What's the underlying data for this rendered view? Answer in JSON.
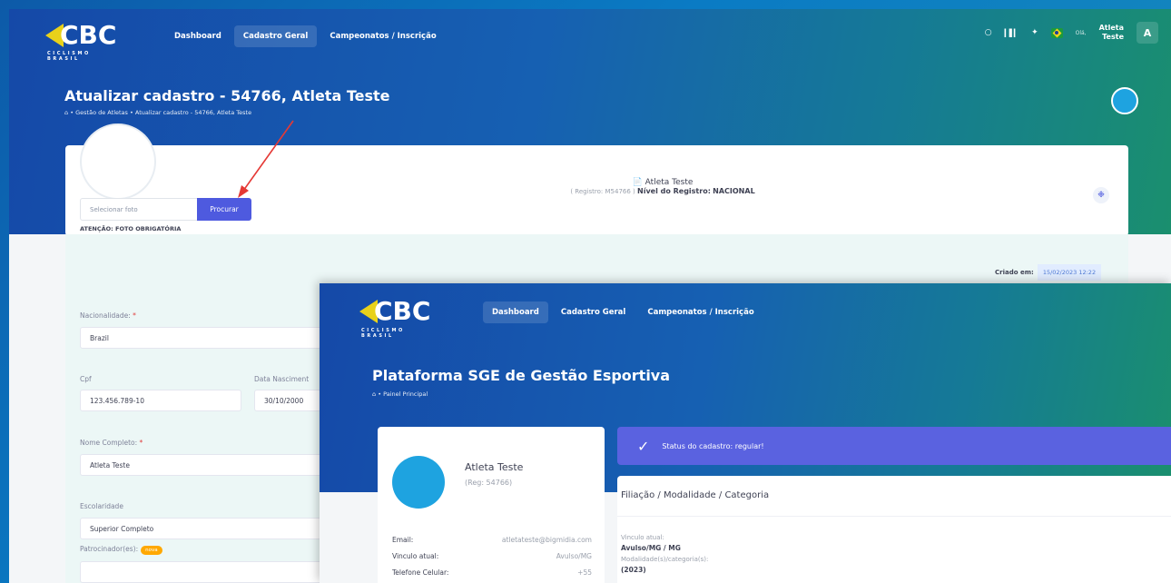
{
  "back": {
    "brand": "CBC",
    "brand_sub": "CICLISMO BRASIL",
    "nav": [
      "Dashboard",
      "Cadastro Geral",
      "Campeonatos / Inscrição"
    ],
    "greeting": "Olá,",
    "user_line1": "Atleta",
    "user_line2": "Teste",
    "avatar_letter": "A",
    "page_title": "Atualizar cadastro - 54766, Atleta Teste",
    "breadcrumb": "• Gestão de Atletas • Atualizar cadastro - 54766, Atleta Teste",
    "file_placeholder": "Selecionar foto",
    "procurar": "Procurar",
    "photo_warning": "ATENÇÃO: FOTO OBRIGATÓRIA",
    "athlete_name": "Atleta Teste",
    "registro": "( Registro: M54766 )",
    "nivel_label": "Nível do Registro:",
    "nivel_value": "NACIONAL",
    "criado_label": "Criado em:",
    "criado_value": "15/02/2023 12:22",
    "nacionalidade_label": "Nacionalidade:",
    "nacionalidade_value": "Brazil",
    "cpf_label": "Cpf",
    "cpf_value": "123.456.789-10",
    "nascimento_label": "Data Nasciment",
    "nascimento_value": "30/10/2000",
    "nome_label": "Nome Completo:",
    "nome_value": "Atleta Teste",
    "escolaridade_label": "Escolaridade",
    "escolaridade_value": "Superior Completo",
    "patrocinador_label": "Patrocinador(es):",
    "nova_badge": "nova"
  },
  "front": {
    "brand": "CBC",
    "brand_sub": "CICLISMO BRASIL",
    "nav": [
      "Dashboard",
      "Cadastro Geral",
      "Campeonatos / Inscrição"
    ],
    "page_title": "Plataforma SGE de Gestão Esportiva",
    "breadcrumb": "• Painel Principal",
    "athlete_name": "Atleta Teste",
    "reg": "(Reg: 54766)",
    "email_label": "Email:",
    "email_value": "atletateste@bigmidia.com",
    "vinculo_label": "Vinculo atual:",
    "vinculo_value": "Avulso/MG",
    "telefone_label": "Telefone Celular:",
    "telefone_value": "+55",
    "status_text": "Status do cadastro: regular!",
    "filiacao_title": "Filiação / Modalidade / Categoria",
    "vinculo_atual_label": "Vinculo atual:",
    "vinculo_atual_value": "Avulso/MG / MG",
    "modalidade_label": "Modalidade(s)/categoria(s):",
    "modalidade_value": "(2023)"
  },
  "colors": {
    "accent": "#4e5adf",
    "brand_yellow": "#e8d11a",
    "arrow": "#e53935"
  }
}
